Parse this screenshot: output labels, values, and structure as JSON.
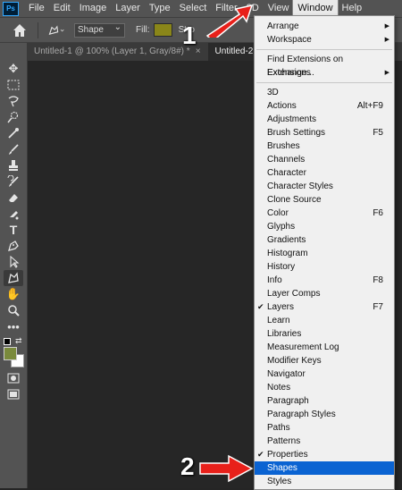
{
  "app": {
    "logo": "Ps"
  },
  "menubar": {
    "items": [
      "File",
      "Edit",
      "Image",
      "Layer",
      "Type",
      "Select",
      "Filter",
      "3D",
      "View",
      "Window",
      "Help"
    ]
  },
  "options": {
    "mode": "Shape",
    "fill_label": "Fill:",
    "stroke_label": "Stroke:",
    "stroke_partial": "Stro",
    "fill_color": "#8a8619"
  },
  "tabs": [
    {
      "label": "Untitled-1 @ 100% (Layer 1, Gray/8#) *",
      "close": "×"
    },
    {
      "label": "Untitled-2 @",
      "close": ""
    }
  ],
  "toolbar": {
    "tools": [
      "move-icon",
      "marquee-icon",
      "lasso-icon",
      "quick-select-icon",
      "eyedropper-icon",
      "brush-icon",
      "stamp-icon",
      "history-brush-icon",
      "eraser-icon",
      "gradient-icon",
      "type-icon",
      "pen-icon",
      "path-select-icon",
      "custom-shape-icon",
      "hand-icon",
      "zoom-icon",
      "more-icon"
    ],
    "foreground_color": "#7a8a3c",
    "background_color": "#ffffff"
  },
  "window_menu": {
    "group1": [
      {
        "label": "Arrange",
        "submenu": true
      },
      {
        "label": "Workspace",
        "submenu": true
      }
    ],
    "group2": [
      {
        "label": "Find Extensions on Exchange...",
        "submenu": false
      },
      {
        "label": "Extensions",
        "submenu": true
      }
    ],
    "group3": [
      {
        "label": "3D",
        "shortcut": ""
      },
      {
        "label": "Actions",
        "shortcut": "Alt+F9"
      },
      {
        "label": "Adjustments",
        "shortcut": ""
      },
      {
        "label": "Brush Settings",
        "shortcut": "F5"
      },
      {
        "label": "Brushes",
        "shortcut": ""
      },
      {
        "label": "Channels",
        "shortcut": ""
      },
      {
        "label": "Character",
        "shortcut": ""
      },
      {
        "label": "Character Styles",
        "shortcut": ""
      },
      {
        "label": "Clone Source",
        "shortcut": ""
      },
      {
        "label": "Color",
        "shortcut": "F6"
      },
      {
        "label": "Glyphs",
        "shortcut": ""
      },
      {
        "label": "Gradients",
        "shortcut": ""
      },
      {
        "label": "Histogram",
        "shortcut": ""
      },
      {
        "label": "History",
        "shortcut": ""
      },
      {
        "label": "Info",
        "shortcut": "F8"
      },
      {
        "label": "Layer Comps",
        "shortcut": ""
      },
      {
        "label": "Layers",
        "shortcut": "F7",
        "checked": true
      },
      {
        "label": "Learn",
        "shortcut": ""
      },
      {
        "label": "Libraries",
        "shortcut": ""
      },
      {
        "label": "Measurement Log",
        "shortcut": ""
      },
      {
        "label": "Modifier Keys",
        "shortcut": ""
      },
      {
        "label": "Navigator",
        "shortcut": ""
      },
      {
        "label": "Notes",
        "shortcut": ""
      },
      {
        "label": "Paragraph",
        "shortcut": ""
      },
      {
        "label": "Paragraph Styles",
        "shortcut": ""
      },
      {
        "label": "Paths",
        "shortcut": ""
      },
      {
        "label": "Patterns",
        "shortcut": ""
      },
      {
        "label": "Properties",
        "shortcut": "",
        "checked": true
      },
      {
        "label": "Shapes",
        "shortcut": "",
        "highlighted": true
      },
      {
        "label": "Styles",
        "shortcut": ""
      }
    ]
  },
  "annotations": {
    "step1": "1",
    "step2": "2",
    "arrow_color": "#e8201a"
  }
}
